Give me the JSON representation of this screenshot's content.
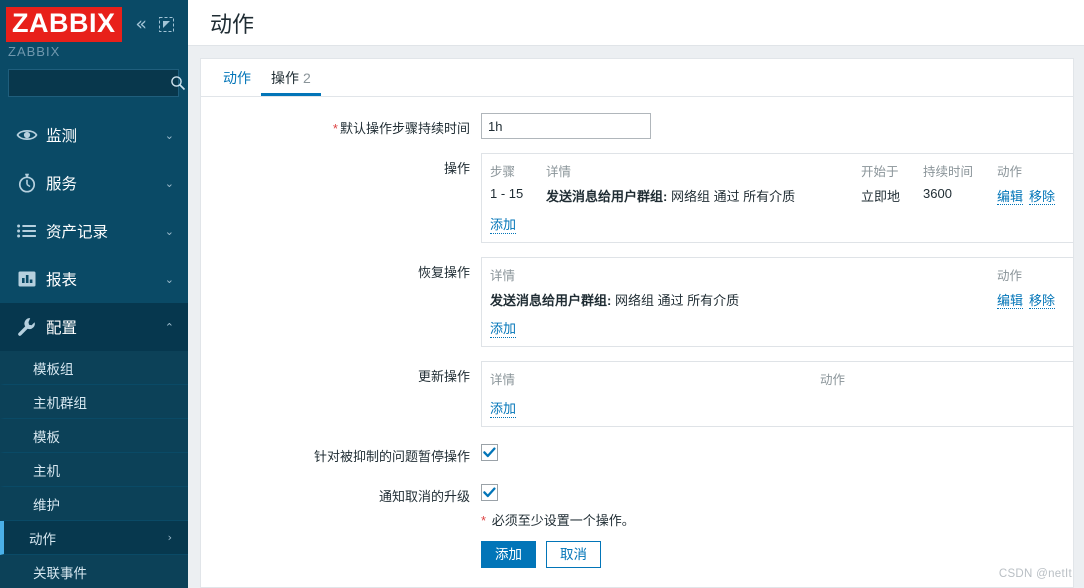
{
  "sidebar": {
    "logo_text": "ZABBIX",
    "subtitle": "ZABBIX",
    "collapse_icon": "«",
    "expand_icon": "expand-icon",
    "search": {
      "value": "",
      "placeholder": ""
    },
    "nav": [
      {
        "label": "监测",
        "icon": "eye-icon",
        "caret": "⌄",
        "active": false
      },
      {
        "label": "服务",
        "icon": "stopwatch-icon",
        "caret": "⌄",
        "active": false
      },
      {
        "label": "资产记录",
        "icon": "list-icon",
        "caret": "⌄",
        "active": false
      },
      {
        "label": "报表",
        "icon": "bar-chart-icon",
        "caret": "⌄",
        "active": false
      },
      {
        "label": "配置",
        "icon": "wrench-icon",
        "caret": "⌃",
        "active": true
      }
    ],
    "submenu": [
      {
        "label": "模板组",
        "active": false,
        "caret": ""
      },
      {
        "label": "主机群组",
        "active": false,
        "caret": ""
      },
      {
        "label": "模板",
        "active": false,
        "caret": ""
      },
      {
        "label": "主机",
        "active": false,
        "caret": ""
      },
      {
        "label": "维护",
        "active": false,
        "caret": ""
      },
      {
        "label": "动作",
        "active": true,
        "caret": "›"
      },
      {
        "label": "关联事件",
        "active": false,
        "caret": ""
      }
    ]
  },
  "header": {
    "title": "动作"
  },
  "tabs": [
    {
      "label": "动作",
      "count": "",
      "active": false
    },
    {
      "label": "操作",
      "count": "2",
      "active": true
    }
  ],
  "form": {
    "duration": {
      "label": "默认操作步骤持续时间",
      "required": "*",
      "value": "1h",
      "placeholder": ""
    },
    "operations": {
      "label": "操作",
      "headers": {
        "step": "步骤",
        "details": "详情",
        "start_in": "开始于",
        "duration": "持续时间",
        "action": "动作"
      },
      "rows": [
        {
          "step": "1 - 15",
          "details_bold": "发送消息给用户群组:",
          "details_rest": " 网络组 通过 所有介质",
          "start_in": "立即地",
          "duration": "3600",
          "edit": "编辑",
          "remove": "移除"
        }
      ],
      "add_label": "添加"
    },
    "recovery_operations": {
      "label": "恢复操作",
      "headers": {
        "details": "详情",
        "action": "动作"
      },
      "rows": [
        {
          "details_bold": "发送消息给用户群组:",
          "details_rest": " 网络组 通过 所有介质",
          "edit": "编辑",
          "remove": "移除"
        }
      ],
      "add_label": "添加"
    },
    "update_operations": {
      "label": "更新操作",
      "headers": {
        "details": "详情",
        "action": "动作"
      },
      "rows": [],
      "add_label": "添加"
    },
    "pause_suppressed": {
      "label": "针对被抑制的问题暂停操作",
      "checked": true
    },
    "notify_cancel": {
      "label": "通知取消的升级",
      "checked": true
    },
    "note": {
      "required": "*",
      "text": "必须至少设置一个操作。"
    },
    "buttons": {
      "submit": "添加",
      "cancel": "取消"
    }
  },
  "watermark": "CSDN @netIt",
  "colors": {
    "sidebar_bg": "#0a4a66",
    "accent": "#0275b8",
    "logo_red": "#e8201a",
    "required_red": "#dd4444"
  }
}
